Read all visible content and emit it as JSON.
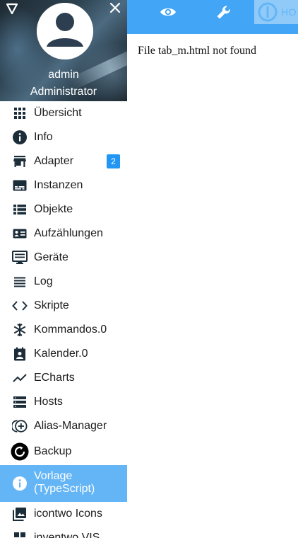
{
  "user": {
    "name": "admin",
    "role": "Administrator"
  },
  "nav": [
    {
      "label": "Übersicht",
      "icon": "apps-icon"
    },
    {
      "label": "Info",
      "icon": "info-icon"
    },
    {
      "label": "Adapter",
      "icon": "store-icon",
      "badge": "2"
    },
    {
      "label": "Instanzen",
      "icon": "subtitles-icon"
    },
    {
      "label": "Objekte",
      "icon": "view-list-icon"
    },
    {
      "label": "Aufzählungen",
      "icon": "enum-icon"
    },
    {
      "label": "Geräte",
      "icon": "devices-icon"
    },
    {
      "label": "Log",
      "icon": "log-icon"
    },
    {
      "label": "Skripte",
      "icon": "code-icon"
    },
    {
      "label": "Kommandos.0",
      "icon": "snowflake-icon"
    },
    {
      "label": "Kalender.0",
      "icon": "calendar-icon"
    },
    {
      "label": "ECharts",
      "icon": "chart-line-icon"
    },
    {
      "label": "Hosts",
      "icon": "storage-icon"
    },
    {
      "label": "Alias-Manager",
      "icon": "alias-icon"
    },
    {
      "label": "Backup",
      "icon": "backup-icon"
    },
    {
      "label": "Vorlage (TypeScript)",
      "icon": "info-icon",
      "active": true
    },
    {
      "label": "icontwo Icons",
      "icon": "image-icon"
    },
    {
      "label": "inventwo VIS",
      "icon": "grid-icon"
    }
  ],
  "topbar": {
    "host_label": "HO"
  },
  "content": {
    "message": "File tab_m.html not found"
  },
  "colors": {
    "primary": "#42a5f5",
    "active": "#64b5f6",
    "badge": "#2196f3",
    "icon": "#1c2d3a"
  }
}
